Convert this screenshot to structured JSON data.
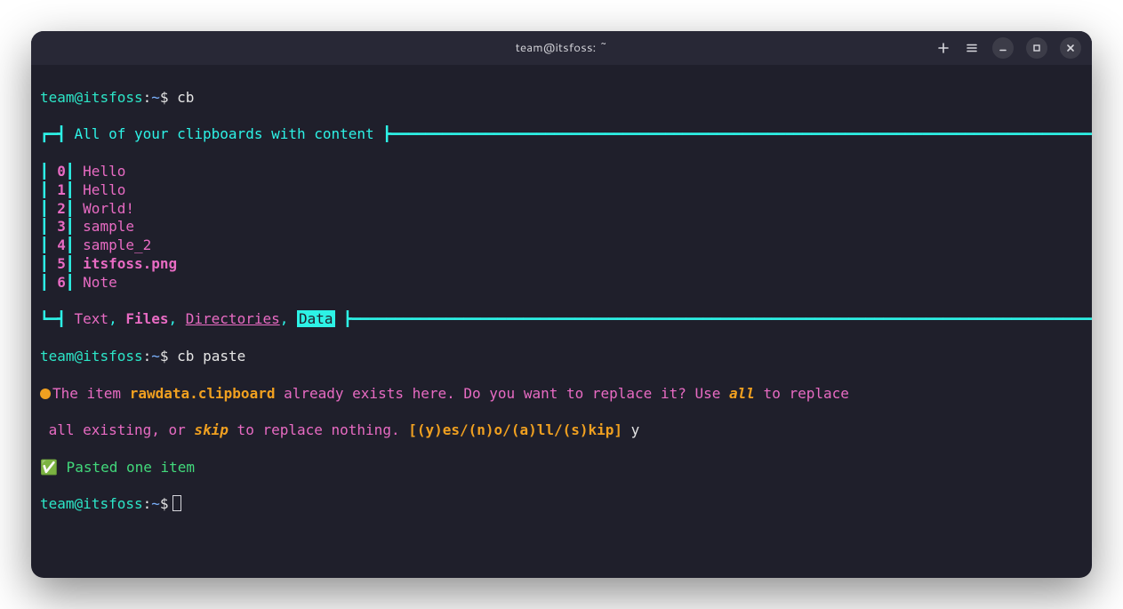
{
  "window": {
    "title": "team@itsfoss: ~"
  },
  "prompt": {
    "user": "team",
    "host": "itsfoss",
    "path": "~",
    "symbol": "$"
  },
  "commands": {
    "cmd1": "cb",
    "cmd2": "cb paste",
    "cmd3": ""
  },
  "box": {
    "header": "All of your clipboards with content",
    "items": [
      {
        "idx": "0",
        "label": "Hello",
        "bold": false
      },
      {
        "idx": "1",
        "label": "Hello",
        "bold": false
      },
      {
        "idx": "2",
        "label": "World!",
        "bold": false
      },
      {
        "idx": "3",
        "label": "sample",
        "bold": false
      },
      {
        "idx": "4",
        "label": "sample_2",
        "bold": false
      },
      {
        "idx": "5",
        "label": "itsfoss.png",
        "bold": true
      },
      {
        "idx": "6",
        "label": "Note",
        "bold": false
      }
    ],
    "footer": {
      "text": "Text",
      "files": "Files",
      "dirs": "Directories",
      "data": "Data"
    }
  },
  "replace_prompt": {
    "pre": "The item ",
    "filename": "rawdata.clipboard",
    "mid1": " already exists here. Do you want to replace it? Use ",
    "all": "all",
    "mid2": " to replace",
    "line2_pre": " all existing, or ",
    "skip": "skip",
    "line2_mid": " to replace nothing. ",
    "options": "[(y)es/(n)o/(a)ll/(s)kip]",
    "answer": " y"
  },
  "success": {
    "check": "✅",
    "msg": " Pasted one item"
  },
  "colors": {
    "cyan": "#2df2e6",
    "magenta": "#e86bc3",
    "orange": "#f0a020",
    "green": "#42d97b",
    "bg": "#1f1f2b"
  }
}
